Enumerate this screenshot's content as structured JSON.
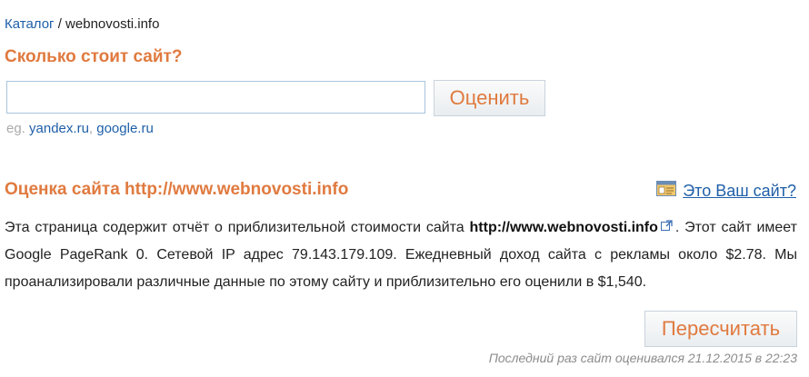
{
  "breadcrumb": {
    "catalog": "Каталог",
    "separator": " / ",
    "current": "webnovosti.info"
  },
  "question_title": "Сколько стоит сайт?",
  "search": {
    "value": "",
    "button": "Оценить"
  },
  "examples": {
    "prefix": "eg. ",
    "ex1": "yandex.ru",
    "sep": ", ",
    "ex2": "google.ru"
  },
  "site_title": "Оценка сайта http://www.webnovosti.info",
  "owner_link": {
    "icon": "id-card-icon",
    "label": "Это Ваш сайт?"
  },
  "paragraph": {
    "part1": "Эта страница содержит отчёт о приблизительной стоимости сайта ",
    "url": "http://www.webnovosti.info",
    "part2": ". Этот сайт имеет Google PageRank 0. Сетевой IP адрес 79.143.179.109. Ежедневный доход сайта с рекламы около $2.78. Мы проанализировали различные данные по этому сайту и приблизительно его оценили в $1,540."
  },
  "recalc_button": "Пересчитать",
  "last_evaluated": "Последний раз сайт оценивался 21.12.2015 в 22:23",
  "colors": {
    "accent": "#e07a3f",
    "link": "#1f5fa8"
  }
}
